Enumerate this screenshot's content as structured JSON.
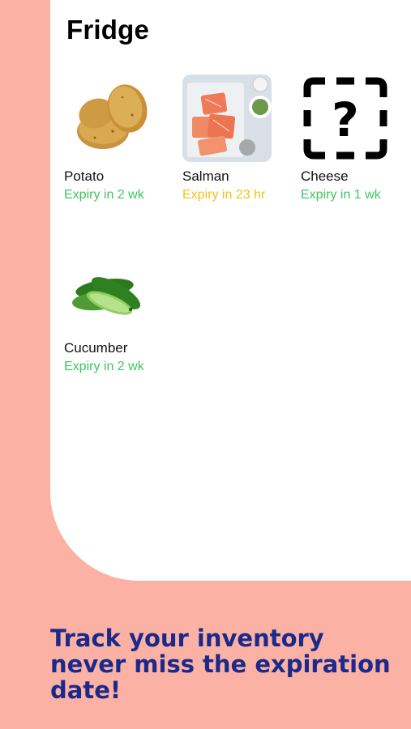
{
  "screen": {
    "title": "Fridge"
  },
  "items": [
    {
      "name": "Potato",
      "expiry": "Expiry in 2 wk",
      "expiry_color": "#3cc85e",
      "icon": "potato-image"
    },
    {
      "name": "Salman",
      "expiry": "Expiry in 23 hr",
      "expiry_color": "#f2c316",
      "icon": "salmon-image"
    },
    {
      "name": "Cheese",
      "expiry": "Expiry in 1 wk",
      "expiry_color": "#3cc85e",
      "icon": "unknown-question-icon"
    },
    {
      "name": "Cucumber",
      "expiry": "Expiry in 2 wk",
      "expiry_color": "#3cc85e",
      "icon": "cucumber-image"
    }
  ],
  "promo": {
    "text": "Track your inventory never miss the expiration date!"
  },
  "colors": {
    "background": "#fbb1a4",
    "card": "#ffffff",
    "promo_text": "#1b2a8a"
  }
}
